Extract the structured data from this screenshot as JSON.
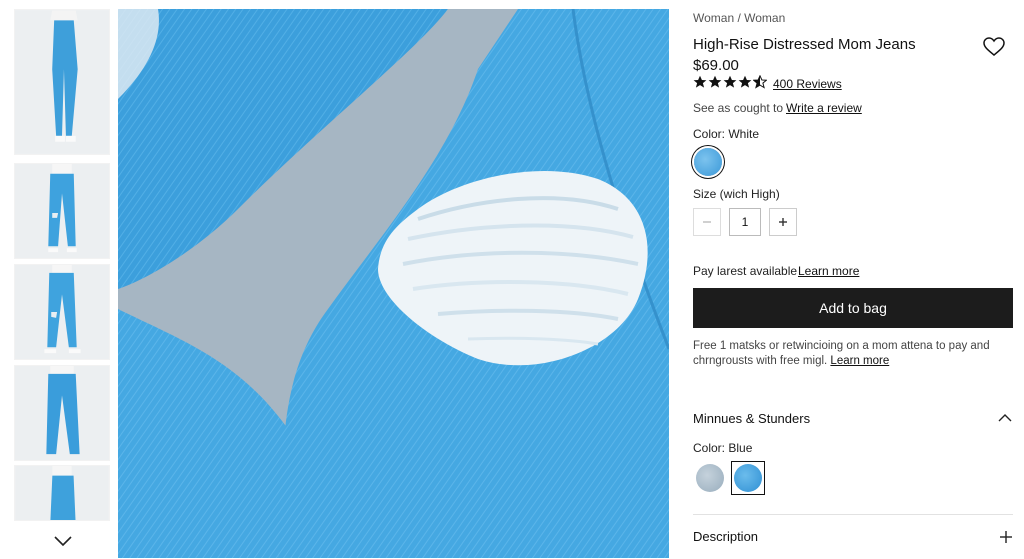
{
  "product": {
    "breadcrumb": "Woman / Woman",
    "title": "High-Rise Distressed Mom Jeans",
    "price": "$69.00",
    "rating": 4.5,
    "reviews_label": "400 Reviews",
    "seen_text": "See as cought to",
    "write_review_label": "Write a review",
    "color_label": "Color: White",
    "size_label": "Size (wich High)",
    "quantity": "1",
    "pay_text": "Pay larest available",
    "pay_learn_more": "Learn more",
    "add_to_bag": "Add to bag",
    "shipping_text": "Free 1 matsks or retwincioing on a mom attena to pay and chrngrousts with free migl.",
    "shipping_learn_more": "Learn more"
  },
  "accordion": {
    "section1_title": "Minnues & Stunders",
    "section1_color_label": "Color: Blue",
    "section2_title": "Description"
  },
  "colors": {
    "swatch_light_blue": "#4fa6dc",
    "swatch_gray": "#a9bccb",
    "swatch_bright_blue": "#3a9be0",
    "button_dark": "#1c1c1c",
    "denim": "#43a6e0"
  },
  "icons": {
    "favorite": "heart-icon",
    "thumbs_down": "chevron-down-icon",
    "collapse": "chevron-up-icon",
    "expand": "plus-icon",
    "quantity_minus": "minus-icon",
    "quantity_plus": "plus-icon",
    "star": "star-icon"
  }
}
